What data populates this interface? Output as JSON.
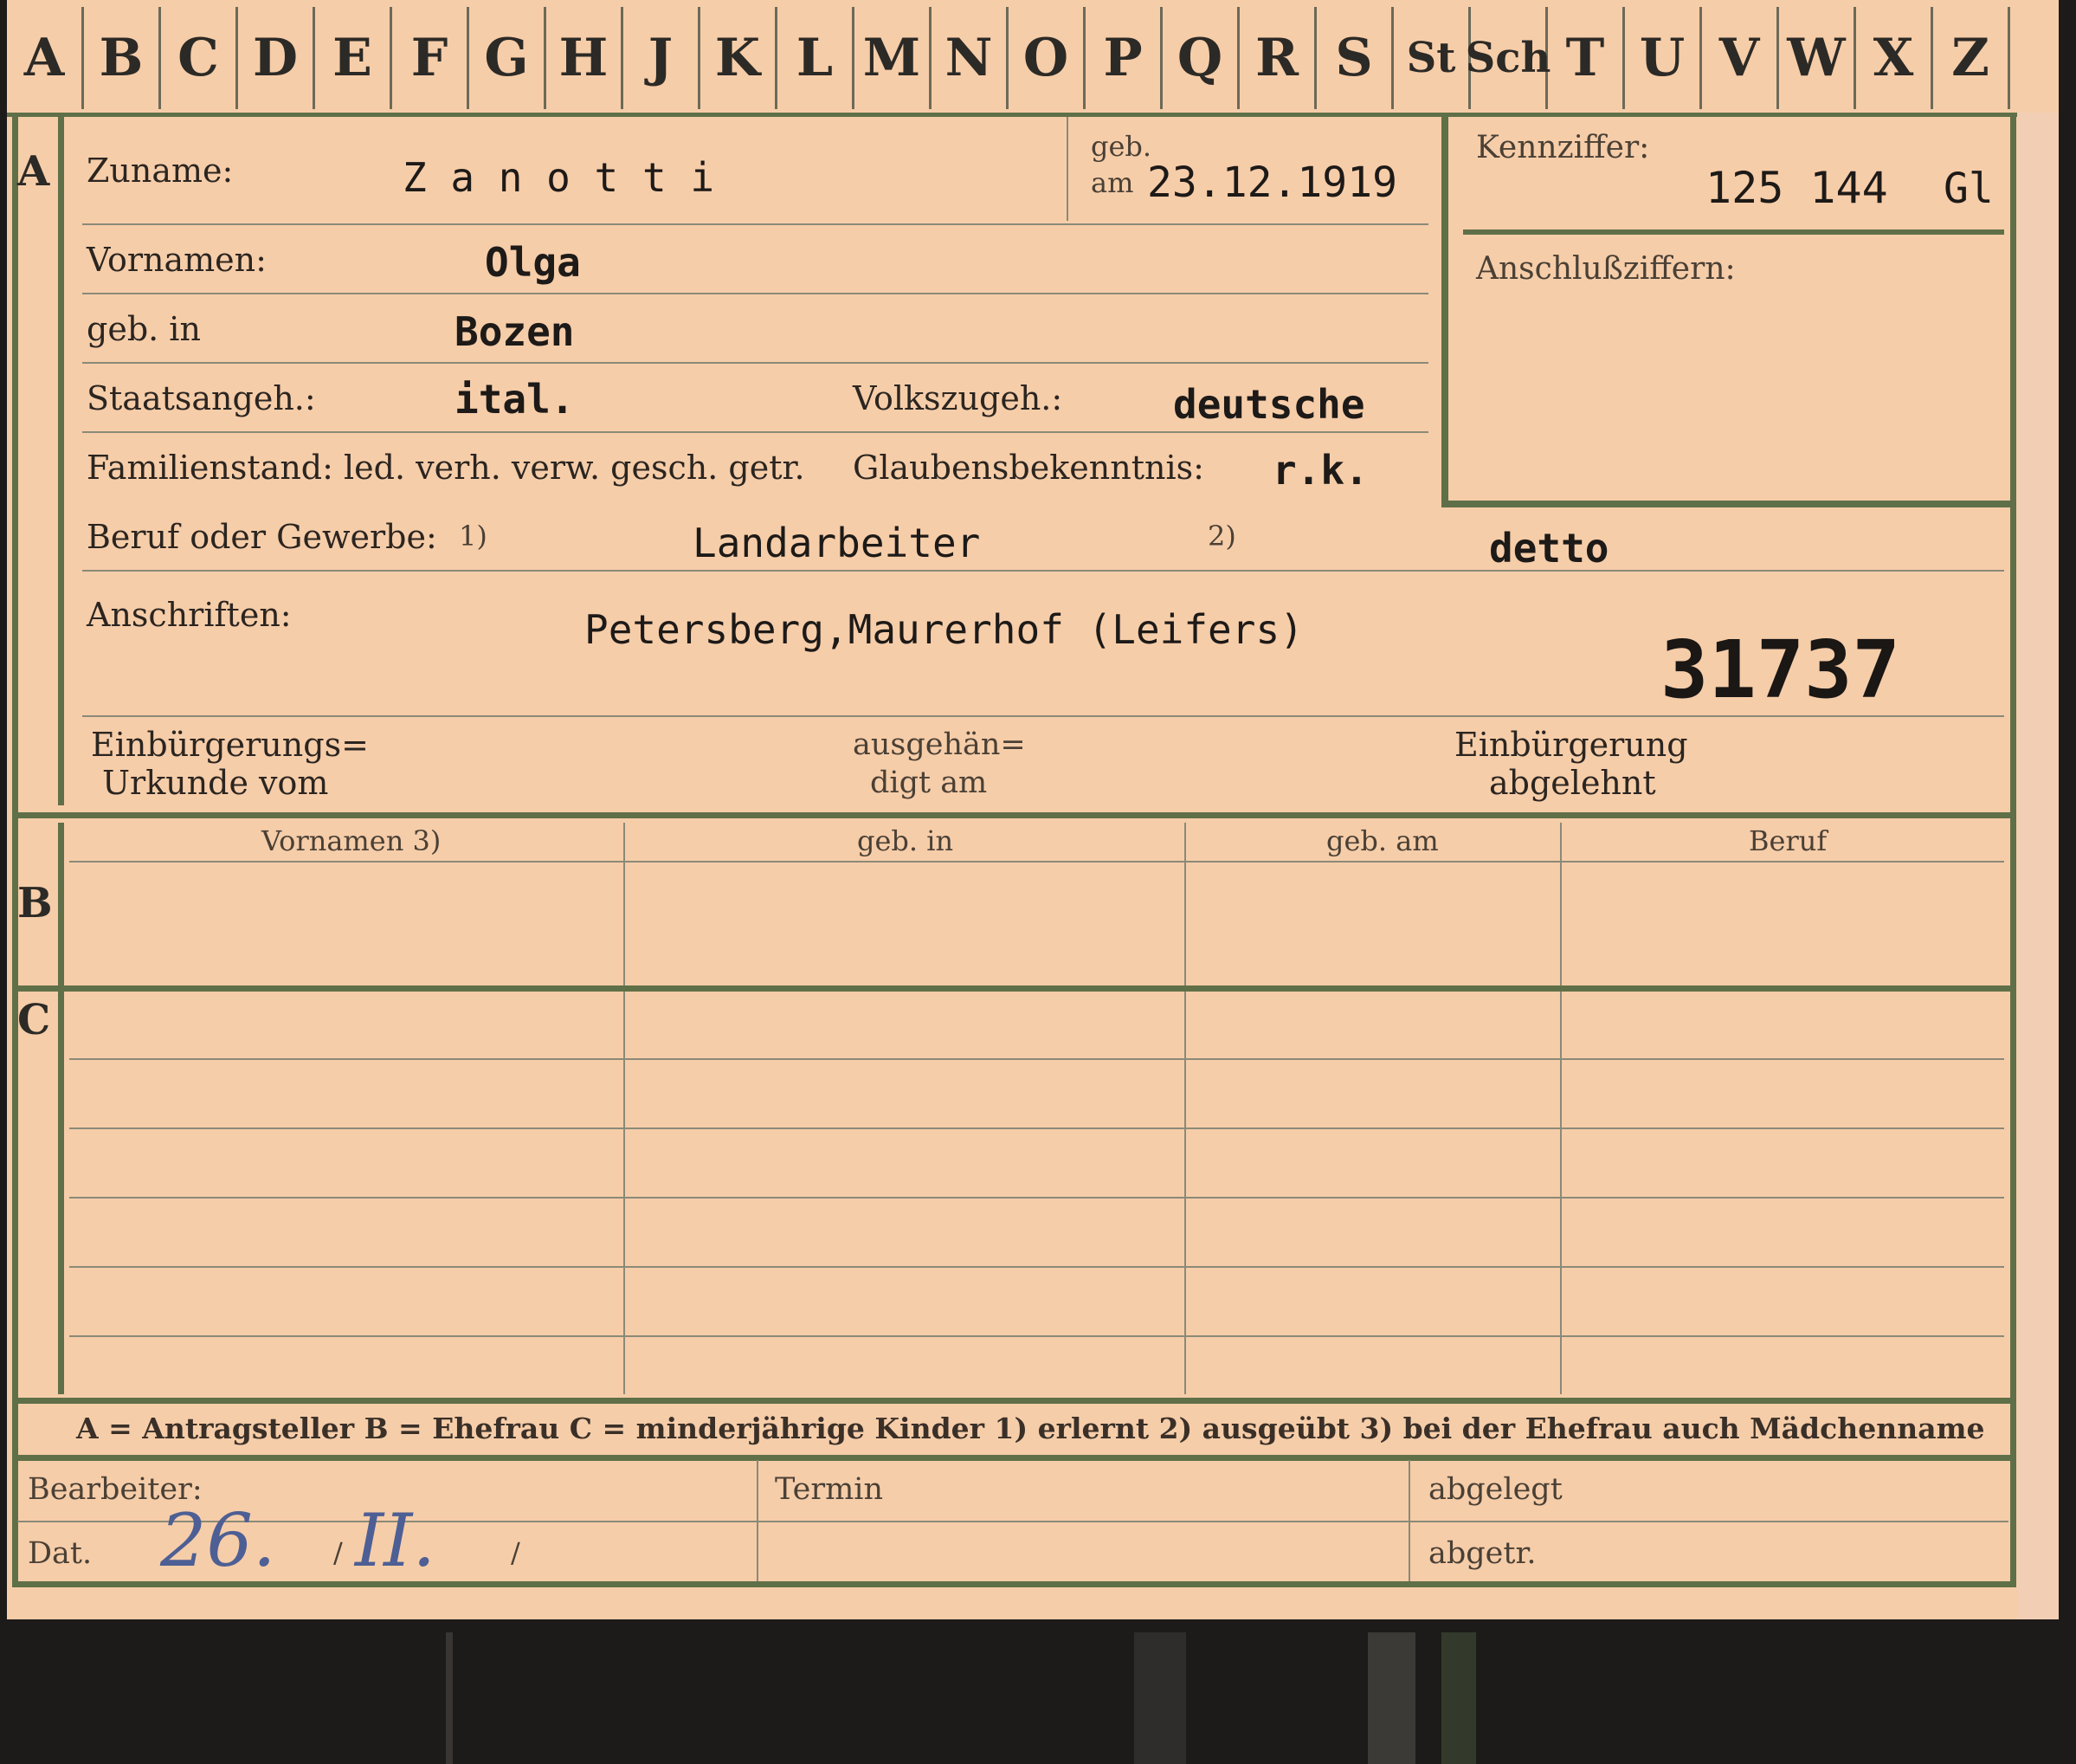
{
  "alphabet_tabs": [
    "A",
    "B",
    "C",
    "D",
    "E",
    "F",
    "G",
    "H",
    "J",
    "K",
    "L",
    "M",
    "N",
    "O",
    "P",
    "Q",
    "R",
    "S",
    "St",
    "Sch",
    "T",
    "U",
    "V",
    "W",
    "X",
    "Z"
  ],
  "sections": {
    "a": "A",
    "b": "B",
    "c": "C"
  },
  "labels": {
    "zuname": "Zuname:",
    "geb_am_1": "geb.",
    "geb_am_2": "am",
    "kennziffer": "Kennziffer:",
    "vornamen": "Vornamen:",
    "anschlussziffern": "Anschlußziffern:",
    "geb_in": "geb. in",
    "staatsangeh": "Staatsangeh.:",
    "volkszugeh": "Volkszugeh.:",
    "familienstand": "Familienstand: led. verh. verw. gesch. getr.",
    "glaubensbekenntnis": "Glaubensbekenntnis:",
    "beruf": "Beruf oder Gewerbe:",
    "beruf_fn1": "1)",
    "beruf_fn2": "2)",
    "anschriften": "Anschriften:",
    "einb_urkunde_1": "Einbürgerungs=",
    "einb_urkunde_2": "Urkunde vom",
    "ausgehaen_1": "ausgehän=",
    "ausgehaen_2": "digt am",
    "einb_abgelehnt_1": "Einbürgerung",
    "einb_abgelehnt_2": "abgelehnt"
  },
  "values": {
    "zuname": "Z a n o t t i",
    "geb_am": "23.12.1919",
    "kennziffer": "125 144",
    "kennziffer_suffix": "Gl",
    "vornamen": "Olga",
    "geb_in": "Bozen",
    "staatsangeh": "ital.",
    "volkszugeh": "deutsche",
    "glaubensbekenntnis": "r.k.",
    "beruf_erlernt": "Landarbeiter",
    "beruf_ausgeuebt": "detto",
    "anschrift": "Petersberg,Maurerhof (Leifers)",
    "stamp_number": "31737"
  },
  "table": {
    "headers": [
      "Vornamen 3)",
      "geb. in",
      "geb. am",
      "Beruf"
    ]
  },
  "legend": {
    "text": "A = Antragsteller   B = Ehefrau   C = minderjährige Kinder   1) erlernt   2) ausgeübt   3) bei der Ehefrau auch Mädchenname"
  },
  "footer": {
    "bearbeiter": "Bearbeiter:",
    "dat": "Dat.",
    "termin": "Termin",
    "abgelegt": "abgelegt",
    "abgetr": "abgetr.",
    "date_hand_day": "26.",
    "date_hand_month": "II.",
    "date_sep": "/"
  },
  "colors": {
    "card": "#f6cda9",
    "frame_green": "#5f7048",
    "handwriting_blue": "#4d5f94"
  }
}
